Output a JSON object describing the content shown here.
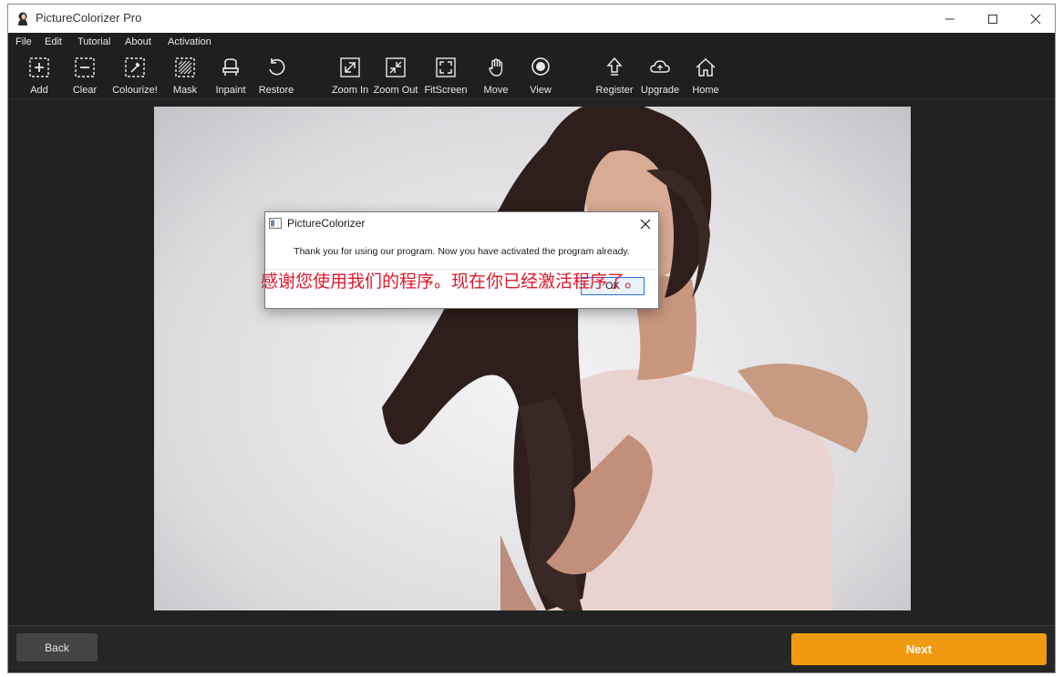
{
  "window": {
    "title": "PictureColorizer Pro"
  },
  "menu": [
    "File",
    "Edit",
    "Tutorial",
    "About",
    "Activation"
  ],
  "toolbar": {
    "add": "Add",
    "clear": "Clear",
    "colourize": "Colourize!",
    "mask": "Mask",
    "inpaint": "Inpaint",
    "restore": "Restore",
    "zoom_in": "Zoom In",
    "zoom_out": "Zoom Out",
    "fitscreen": "FitScreen",
    "move": "Move",
    "view": "View",
    "register": "Register",
    "upgrade": "Upgrade",
    "home": "Home"
  },
  "dialog": {
    "title": "PictureColorizer",
    "message": "Thank you for using our program. Now you have activated the program already.",
    "ok_label": "OK"
  },
  "overlay_text": "感谢您使用我们的程序。现在你已经激活程序了。",
  "buttons": {
    "back": "Back",
    "next": "Next"
  },
  "colors": {
    "accent": "#f09a11",
    "overlay_text": "#e0192a",
    "dialog_focus": "#2b73d8"
  }
}
